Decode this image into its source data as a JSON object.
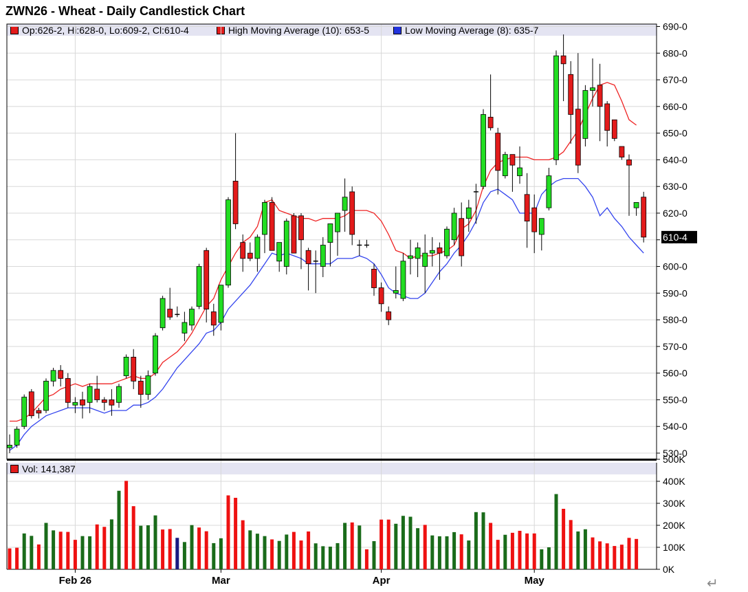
{
  "title": "ZWN26 - Wheat - Daily Candlestick Chart",
  "legend": {
    "ohlc": "Op:626-2, Hi:628-0, Lo:609-2, Cl:610-4",
    "high_ma": "High Moving Average (10): 653-5",
    "low_ma": "Low Moving Average (8): 635-7"
  },
  "volume_label": "Vol: 141,387",
  "last_price_label": "610-4",
  "return_glyph": "↵",
  "colors": {
    "up": "#22dd22",
    "down": "#e31b1b",
    "high_ma": "#ee2222",
    "low_ma": "#3344ee",
    "vol_up": "#1a6b1a",
    "vol_down": "#ee1111",
    "vol_flat": "#1a1a80",
    "legend_bg": "#e4e4f2"
  },
  "chart_data": [
    {
      "type": "candlestick",
      "title": "ZWN26 - Wheat - Daily Candlestick Chart",
      "ylim": [
        530,
        690
      ],
      "price_ticks": [
        "690-0",
        "680-0",
        "670-0",
        "660-0",
        "650-0",
        "640-0",
        "630-0",
        "620-0",
        "610-0",
        "600-0",
        "590-0",
        "580-0",
        "570-0",
        "560-0",
        "550-0",
        "540-0",
        "530-0"
      ],
      "price_tick_values": [
        690,
        680,
        670,
        660,
        650,
        640,
        630,
        620,
        610,
        600,
        590,
        580,
        570,
        560,
        550,
        540,
        530
      ],
      "x_labels": [
        "Feb 26",
        "Mar",
        "Apr",
        "May"
      ],
      "x_label_index": [
        9,
        29,
        51,
        72
      ],
      "grid": true,
      "candles": [
        [
          532,
          537,
          530,
          533
        ],
        [
          533,
          540,
          532,
          539
        ],
        [
          540,
          552,
          539,
          551
        ],
        [
          553,
          554,
          543,
          544
        ],
        [
          546,
          547,
          543,
          545
        ],
        [
          546,
          558,
          545,
          557
        ],
        [
          557,
          562,
          555,
          561
        ],
        [
          561,
          563,
          555,
          558
        ],
        [
          558,
          560,
          547,
          549
        ],
        [
          548,
          551,
          545,
          549
        ],
        [
          550,
          553,
          543,
          548
        ],
        [
          549,
          556,
          545,
          555
        ],
        [
          554,
          559,
          549,
          550
        ],
        [
          550,
          551,
          546,
          549
        ],
        [
          550,
          554,
          544,
          548
        ],
        [
          549,
          556,
          547,
          555
        ],
        [
          559,
          567,
          558,
          566
        ],
        [
          566,
          569,
          554,
          557
        ],
        [
          557,
          559,
          547,
          552
        ],
        [
          552,
          561,
          550,
          559
        ],
        [
          560,
          575,
          559,
          574
        ],
        [
          577,
          589,
          576,
          588
        ],
        [
          584,
          592,
          580,
          581
        ],
        [
          582,
          585,
          581,
          582
        ],
        [
          575,
          583,
          572,
          579
        ],
        [
          578,
          585,
          576,
          584
        ],
        [
          585,
          601,
          584,
          600
        ],
        [
          606,
          607,
          579,
          584
        ],
        [
          583,
          586,
          574,
          578
        ],
        [
          579,
          593,
          576,
          593
        ],
        [
          593,
          626,
          592,
          625
        ],
        [
          632,
          650,
          614,
          616
        ],
        [
          609,
          612,
          598,
          603
        ],
        [
          605,
          609,
          602,
          603
        ],
        [
          603,
          612,
          598,
          611
        ],
        [
          612,
          625,
          605,
          624
        ],
        [
          624,
          626,
          606,
          606
        ],
        [
          602,
          609,
          598,
          609
        ],
        [
          600,
          618,
          597,
          617
        ],
        [
          619,
          620,
          605,
          605
        ],
        [
          619,
          620,
          599,
          610
        ],
        [
          606,
          607,
          591,
          601
        ],
        [
          602,
          606,
          590,
          602
        ],
        [
          600,
          611,
          596,
          608
        ],
        [
          609,
          616,
          600,
          616
        ],
        [
          613,
          620,
          604,
          620
        ],
        [
          621,
          633,
          613,
          626
        ],
        [
          628,
          630,
          608,
          612
        ],
        [
          608,
          610,
          604,
          608
        ],
        [
          608,
          610,
          607,
          608
        ],
        [
          599,
          601,
          589,
          592
        ],
        [
          592,
          594,
          583,
          586
        ],
        [
          583,
          585,
          578,
          580
        ],
        [
          590,
          600,
          588,
          591
        ],
        [
          588,
          605,
          587,
          602
        ],
        [
          603,
          610,
          597,
          604
        ],
        [
          603,
          609,
          596,
          607
        ],
        [
          600,
          612,
          590,
          605
        ],
        [
          605,
          611,
          600,
          606
        ],
        [
          607,
          609,
          595,
          605
        ],
        [
          604,
          615,
          603,
          614
        ],
        [
          610,
          622,
          608,
          620
        ],
        [
          618,
          624,
          600,
          604
        ],
        [
          618,
          625,
          613,
          622
        ],
        [
          628,
          631,
          616,
          628
        ],
        [
          630,
          659,
          629,
          657
        ],
        [
          656,
          672,
          651,
          652
        ],
        [
          650,
          652,
          627,
          636
        ],
        [
          634,
          643,
          633,
          642
        ],
        [
          642,
          642,
          628,
          638
        ],
        [
          634,
          645,
          631,
          637
        ],
        [
          627,
          635,
          607,
          617
        ],
        [
          622,
          627,
          605,
          613
        ],
        [
          612,
          618,
          606,
          618
        ],
        [
          622,
          637,
          621,
          634
        ],
        [
          640,
          681,
          638,
          679
        ],
        [
          679,
          687,
          662,
          676
        ],
        [
          672,
          677,
          646,
          657
        ],
        [
          659,
          680,
          635,
          638
        ],
        [
          648,
          668,
          645,
          666
        ],
        [
          666,
          678,
          660,
          667
        ],
        [
          668,
          676,
          647,
          660
        ],
        [
          661,
          662,
          645,
          651
        ],
        [
          655,
          652,
          647,
          648
        ],
        [
          645,
          645,
          640,
          641
        ],
        [
          640,
          642,
          619,
          638
        ],
        [
          622,
          623,
          619,
          624
        ],
        [
          626,
          628,
          609,
          611
        ]
      ],
      "high_ma_series": {
        "name": "High Moving Average (10)",
        "start_index": 0,
        "values": [
          542,
          542,
          543,
          545,
          548,
          551,
          552,
          554,
          555,
          556,
          555,
          556,
          556,
          556,
          556,
          557,
          558,
          559,
          558,
          558,
          560,
          564,
          566,
          568,
          571,
          575,
          580,
          585,
          588,
          595,
          600,
          605,
          609,
          611,
          615,
          624,
          625,
          621,
          620,
          619,
          618,
          618,
          617,
          618,
          618,
          618,
          619,
          621,
          621,
          621,
          620,
          617,
          612,
          606,
          605,
          603,
          604,
          604,
          604,
          605,
          606,
          608,
          614,
          616,
          621,
          630,
          636,
          639,
          640,
          641,
          641,
          641,
          640,
          640,
          640,
          641,
          643,
          647,
          651,
          657,
          663,
          668,
          669,
          668,
          662,
          655,
          653
        ]
      },
      "low_ma_series": {
        "name": "Low Moving Average (8)",
        "start_index": 0,
        "values": [
          531,
          533,
          537,
          540,
          542,
          544,
          545,
          546,
          547,
          547,
          547,
          547,
          546,
          545,
          546,
          546,
          546,
          548,
          548,
          549,
          551,
          554,
          558,
          562,
          565,
          568,
          571,
          575,
          576,
          579,
          584,
          587,
          590,
          593,
          597,
          601,
          605,
          604,
          605,
          604,
          603,
          601,
          601,
          601,
          601,
          603,
          603,
          603,
          604,
          603,
          601,
          597,
          592,
          590,
          589,
          588,
          588,
          590,
          594,
          598,
          601,
          605,
          608,
          612,
          617,
          624,
          628,
          629,
          627,
          625,
          620,
          620,
          620,
          627,
          630,
          632,
          633,
          633,
          633,
          630,
          626,
          619,
          622,
          618,
          615,
          611,
          608,
          605
        ]
      },
      "volume": {
        "label": "Vol: 141,387",
        "ylim": [
          0,
          500
        ],
        "ticks": [
          "500K",
          "400K",
          "300K",
          "200K",
          "100K",
          "0K"
        ],
        "tick_values": [
          500,
          400,
          300,
          200,
          100,
          0
        ],
        "values": [
          95,
          98,
          163,
          152,
          113,
          211,
          177,
          171,
          170,
          134,
          151,
          150,
          204,
          193,
          227,
          357,
          402,
          287,
          198,
          200,
          245,
          181,
          183,
          143,
          124,
          201,
          190,
          173,
          119,
          141,
          336,
          325,
          223,
          177,
          162,
          151,
          136,
          129,
          158,
          170,
          131,
          172,
          118,
          105,
          103,
          119,
          211,
          213,
          199,
          91,
          128,
          226,
          226,
          207,
          243,
          239,
          187,
          202,
          154,
          150,
          150,
          169,
          159,
          131,
          260,
          259,
          211,
          134,
          157,
          166,
          175,
          163,
          163,
          91,
          100,
          342,
          275,
          224,
          172,
          182,
          145,
          127,
          118,
          106,
          112,
          143,
          138
        ],
        "directions": [
          "d",
          "d",
          "u",
          "u",
          "d",
          "u",
          "u",
          "d",
          "d",
          "d",
          "u",
          "u",
          "d",
          "d",
          "u",
          "u",
          "d",
          "d",
          "u",
          "u",
          "u",
          "d",
          "d",
          "f",
          "u",
          "u",
          "d",
          "d",
          "u",
          "u",
          "d",
          "d",
          "d",
          "u",
          "u",
          "u",
          "d",
          "u",
          "u",
          "d",
          "d",
          "d",
          "u",
          "u",
          "u",
          "u",
          "u",
          "d",
          "u",
          "d",
          "u",
          "d",
          "d",
          "u",
          "u",
          "u",
          "u",
          "d",
          "u",
          "u",
          "u",
          "u",
          "d",
          "u",
          "u",
          "u",
          "d",
          "d",
          "u",
          "d",
          "d",
          "d",
          "d",
          "u",
          "u",
          "u",
          "d",
          "d",
          "u",
          "u",
          "d",
          "d",
          "d",
          "d",
          "d",
          "d",
          "d"
        ]
      }
    }
  ]
}
